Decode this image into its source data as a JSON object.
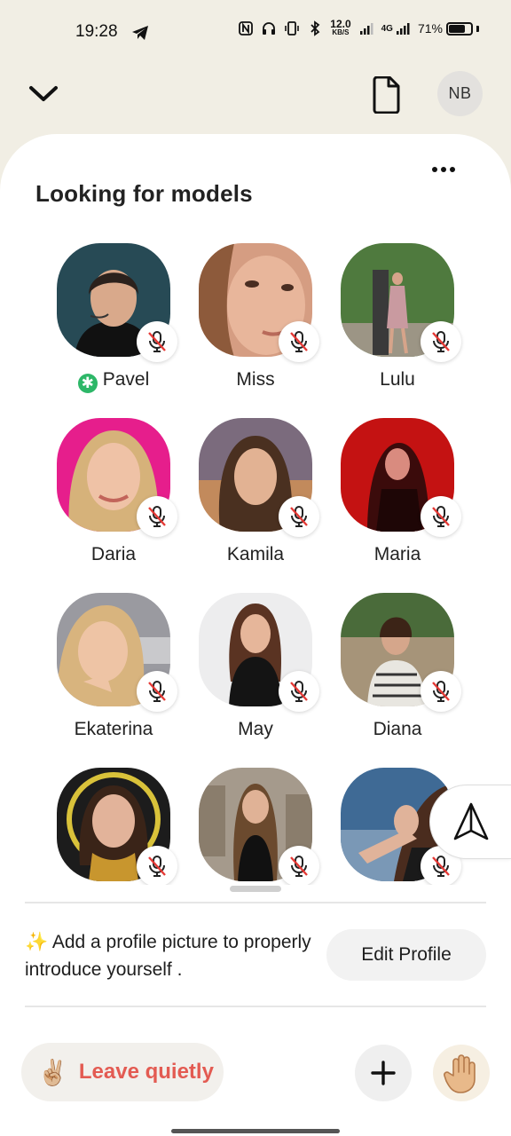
{
  "status_bar": {
    "time": "19:28",
    "speed_value": "12.0",
    "speed_unit": "KB/S",
    "network": "4G",
    "battery_percent": "71%",
    "battery_level": 0.71
  },
  "header": {
    "avatar_initials": "NB",
    "collapse_icon": "chevron-down-icon",
    "document_icon": "document-icon"
  },
  "room": {
    "title": "Looking for models",
    "menu_icon": "more-horizontal-icon",
    "speakers": [
      {
        "name": "Pavel",
        "moderator": true,
        "muted": true
      },
      {
        "name": "Miss",
        "muted": true
      },
      {
        "name": "Lulu",
        "muted": true
      },
      {
        "name": "Daria",
        "muted": true
      },
      {
        "name": "Kamila",
        "muted": true
      },
      {
        "name": "Maria",
        "muted": true
      },
      {
        "name": "Ekaterina",
        "muted": true
      },
      {
        "name": "May",
        "muted": true
      },
      {
        "name": "Diana",
        "muted": true
      },
      {
        "name": "",
        "muted": true
      },
      {
        "name": "",
        "muted": true
      },
      {
        "name": "",
        "muted": true
      }
    ]
  },
  "profile_notice": {
    "emoji": "✨",
    "text": "Add a profile picture to properly introduce yourself .",
    "button_label": "Edit Profile"
  },
  "bottom_bar": {
    "leave_emoji": "✌🏼",
    "leave_label": "Leave quietly",
    "add_icon": "plus-icon",
    "raise_hand_icon": "raise-hand-icon"
  },
  "colors": {
    "background": "#f1eee4",
    "leave_text": "#e35b52",
    "moderator_badge": "#2db768"
  }
}
